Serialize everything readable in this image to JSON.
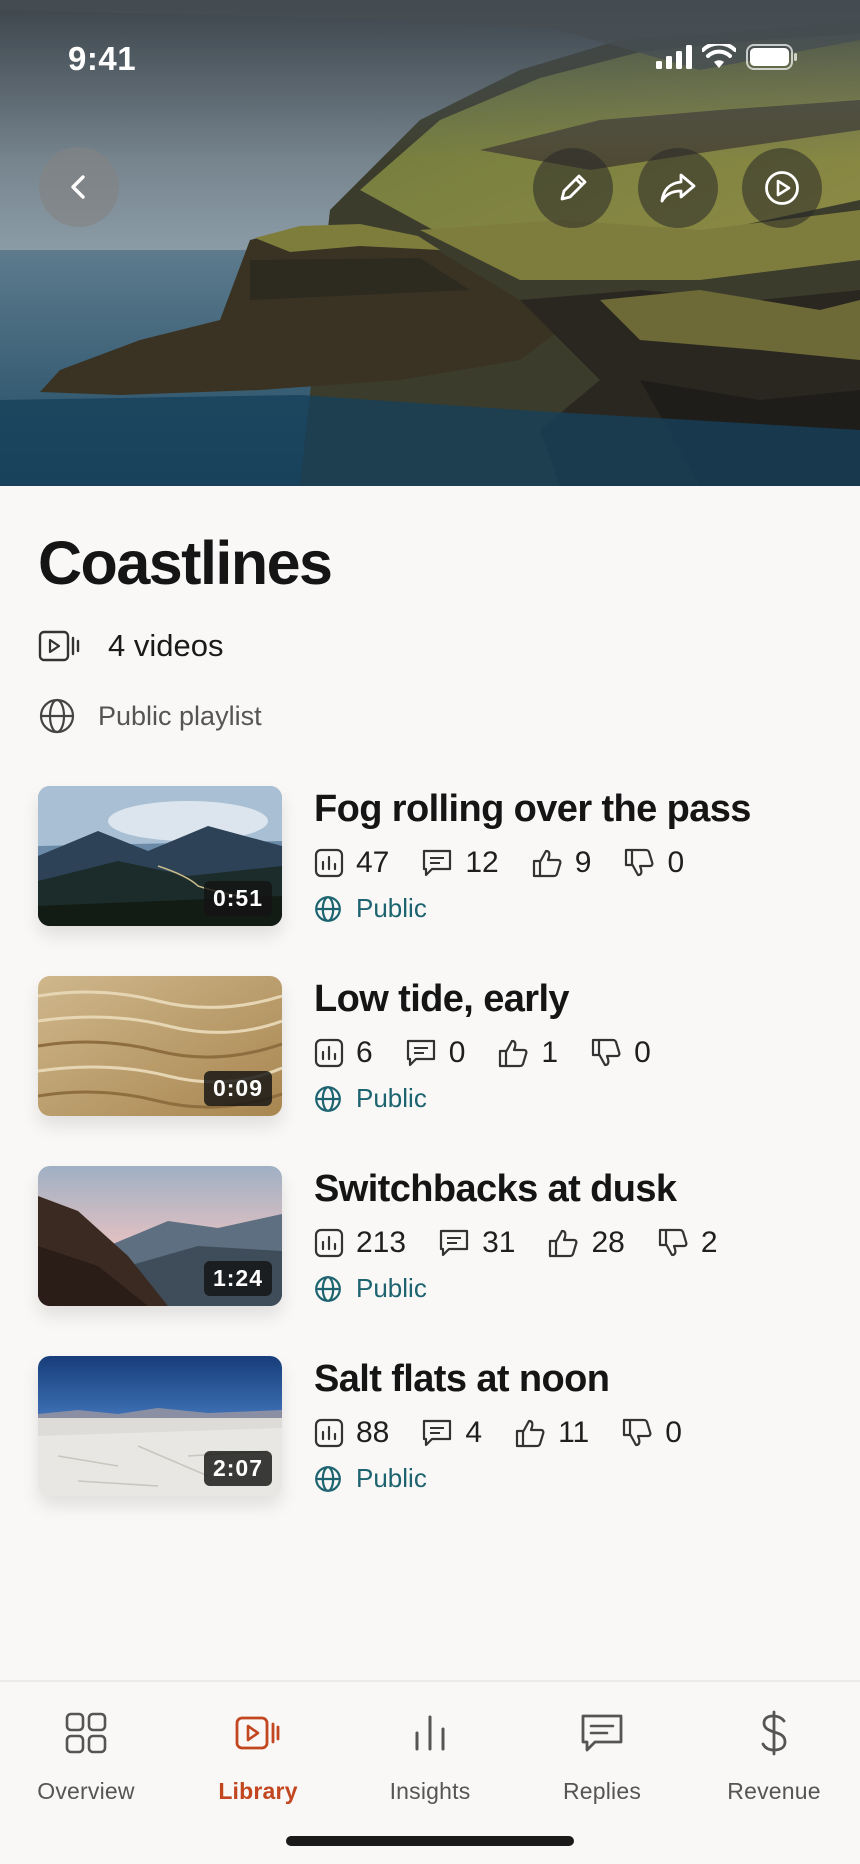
{
  "status_bar": {
    "time": "9:41"
  },
  "header": {
    "back_icon": "chevron-left-icon",
    "actions": [
      "pencil-icon",
      "share-arrow-icon",
      "play-circle-icon"
    ]
  },
  "playlist": {
    "title": "Coastlines",
    "video_count": "4 videos",
    "visibility": "Public playlist"
  },
  "videos": [
    {
      "title": "Fog rolling over the pass",
      "duration": "0:51",
      "views": "47",
      "comments": "12",
      "likes": "9",
      "dislikes": "0",
      "visibility": "Public"
    },
    {
      "title": "Low tide, early",
      "duration": "0:09",
      "views": "6",
      "comments": "0",
      "likes": "1",
      "dislikes": "0",
      "visibility": "Public"
    },
    {
      "title": "Switchbacks at dusk",
      "duration": "1:24",
      "views": "213",
      "comments": "31",
      "likes": "28",
      "dislikes": "2",
      "visibility": "Public"
    },
    {
      "title": "Salt flats at noon",
      "duration": "2:07",
      "views": "88",
      "comments": "4",
      "likes": "11",
      "dislikes": "0",
      "visibility": "Public"
    }
  ],
  "tab_bar": {
    "tabs": [
      {
        "label": "Overview",
        "icon": "grid-icon"
      },
      {
        "label": "Library",
        "icon": "video-library-icon",
        "active": true
      },
      {
        "label": "Insights",
        "icon": "bar-chart-icon"
      },
      {
        "label": "Replies",
        "icon": "message-icon"
      },
      {
        "label": "Revenue",
        "icon": "dollar-icon"
      }
    ]
  },
  "colors": {
    "accent": "#c2461f",
    "public_teal": "#1d6470",
    "background": "#f9f8f6"
  }
}
